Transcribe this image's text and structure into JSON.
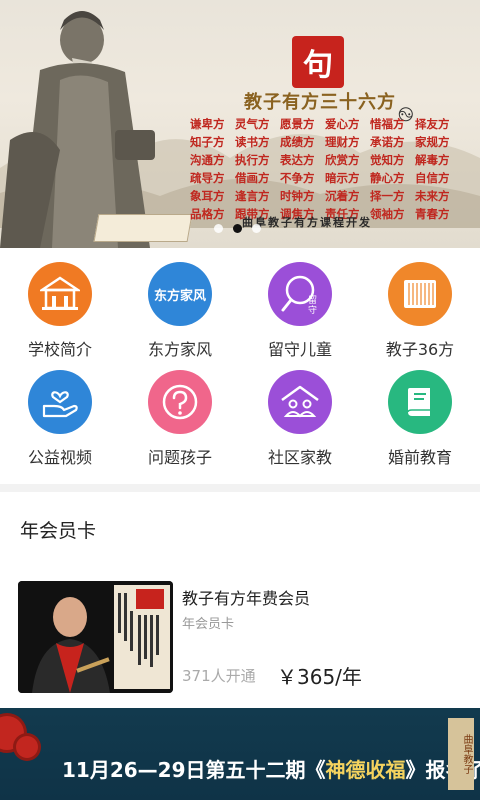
{
  "banner": {
    "seal_char": "句",
    "title": "教子有方三十六方",
    "phrases": [
      "谦卑方",
      "灵气方",
      "愿景方",
      "爱心方",
      "惜福方",
      "择友方",
      "知子方",
      "读书方",
      "成绩方",
      "理财方",
      "承诺方",
      "家规方",
      "沟通方",
      "执行方",
      "表达方",
      "欣赏方",
      "觉知方",
      "解毒方",
      "疏导方",
      "借画方",
      "不争方",
      "暗示方",
      "静心方",
      "自信方",
      "象耳方",
      "逢言方",
      "时钟方",
      "沉着方",
      "择一方",
      "未来方",
      "品格方",
      "跟带方",
      "调焦方",
      "责任方",
      "领袖方",
      "青春方"
    ],
    "subtitle": "曲阜教子有方课程开发",
    "slides": 3,
    "active_slide": 1
  },
  "menu": [
    {
      "label": "学校简介",
      "icon": "school-building-icon",
      "color": "#f07a23"
    },
    {
      "label": "东方家风",
      "icon": "dongfang-jiafeng-logo-icon",
      "color": "#2f86d8",
      "logo_text": "东方家风"
    },
    {
      "label": "留守儿童",
      "icon": "magnifier-child-icon",
      "color": "#9b4fd8",
      "inner_text": "留守"
    },
    {
      "label": "教子36方",
      "icon": "bamboo-scroll-icon",
      "color": "#f0872a"
    },
    {
      "label": "公益视频",
      "icon": "heart-hand-icon",
      "color": "#2f86d8"
    },
    {
      "label": "问题孩子",
      "icon": "question-icon",
      "color": "#f0668b"
    },
    {
      "label": "社区家教",
      "icon": "community-house-icon",
      "color": "#9b4fd8"
    },
    {
      "label": "婚前教育",
      "icon": "book-icon",
      "color": "#28b880"
    }
  ],
  "section": {
    "title": "年会员卡",
    "card": {
      "name": "教子有方年费会员",
      "subtitle": "年会员卡",
      "count": "371人开通",
      "price": "￥365/年"
    }
  },
  "bottom_banner": {
    "text_before": "11月26—29日第五十二期《",
    "text_highlight": "神德收福",
    "text_after": "》报名了",
    "seal_text": "曲阜教子"
  }
}
